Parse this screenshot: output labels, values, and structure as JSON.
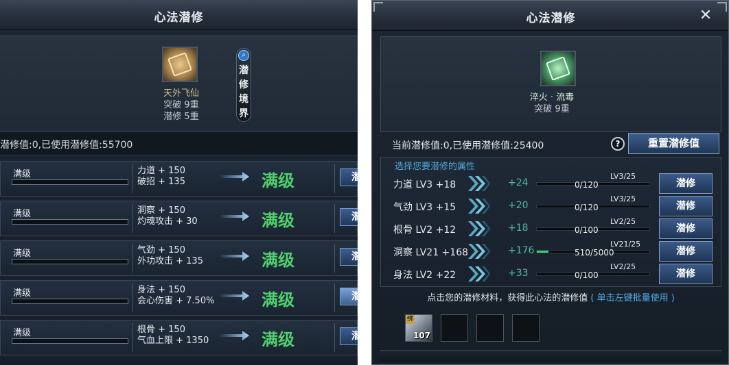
{
  "left_panel": {
    "title": "心法潜修",
    "skill": {
      "name": "天外飞仙",
      "breakthrough": "突破 9重",
      "cultivation": "潜修 5重"
    },
    "realm_button_label": "潜修境界",
    "value_text": "潜修值:0,已使用潜修值:55700",
    "rows": [
      {
        "level": "满级",
        "attr1": "力道 + 150",
        "attr2": "破招 + 135",
        "status": "满级",
        "button": "潜修",
        "active": false
      },
      {
        "level": "满级",
        "attr1": "洞察 + 150",
        "attr2": "灼魂攻击 + 30",
        "status": "满级",
        "button": "潜修",
        "active": false
      },
      {
        "level": "满级",
        "attr1": "气劲 + 150",
        "attr2": "外功攻击 + 135",
        "status": "满级",
        "button": "潜修",
        "active": false
      },
      {
        "level": "满级",
        "attr1": "身法 + 150",
        "attr2": "会心伤害 + 7.50%",
        "status": "满级",
        "button": "潜修",
        "active": true
      },
      {
        "level": "满级",
        "attr1": "根骨 + 150",
        "attr2": "气血上限 + 1350",
        "status": "满级",
        "button": "潜修",
        "active": false
      }
    ]
  },
  "right_panel": {
    "title": "心法潜修",
    "close_label": "✕",
    "skill": {
      "name": "淬火 · 流毒",
      "breakthrough": "突破 9重"
    },
    "value_text": "当前潜修值:0,已使用潜修值:25400",
    "help_label": "?",
    "reset_button": "重置潜修值",
    "list_hint": "选择您要潜修的属性",
    "rows": [
      {
        "name": "力道 LV3 +18",
        "gain": "+24",
        "target_level": "LV3/25",
        "progress": "0/120",
        "fill_fraction": 0.0,
        "button": "潜修"
      },
      {
        "name": "气劲 LV3 +15",
        "gain": "+20",
        "target_level": "LV3/25",
        "progress": "0/120",
        "fill_fraction": 0.0,
        "button": "潜修"
      },
      {
        "name": "根骨 LV2 +12",
        "gain": "+18",
        "target_level": "LV2/25",
        "progress": "0/100",
        "fill_fraction": 0.0,
        "button": "潜修"
      },
      {
        "name": "洞察 LV21 +168",
        "gain": "+176",
        "target_level": "LV21/25",
        "progress": "510/5000",
        "fill_fraction": 0.102,
        "button": "潜修"
      },
      {
        "name": "身法 LV2 +22",
        "gain": "+33",
        "target_level": "LV2/25",
        "progress": "0/100",
        "fill_fraction": 0.0,
        "button": "潜修"
      }
    ],
    "material_hint": "点击您的潜修材料，获得此心法的潜修值",
    "material_hint_link": "( 单击左键批量使用 )",
    "slots": [
      {
        "filled": true,
        "tag": "绑",
        "count": "107"
      },
      {
        "filled": false
      },
      {
        "filled": false
      },
      {
        "filled": false
      }
    ]
  },
  "colors": {
    "max_level_green": "#4fd06c",
    "gain_teal": "#53b7a3",
    "hint_blue": "#4fa8d8",
    "button_blue": "#3a5a88",
    "progress_green": "#39d06b"
  }
}
